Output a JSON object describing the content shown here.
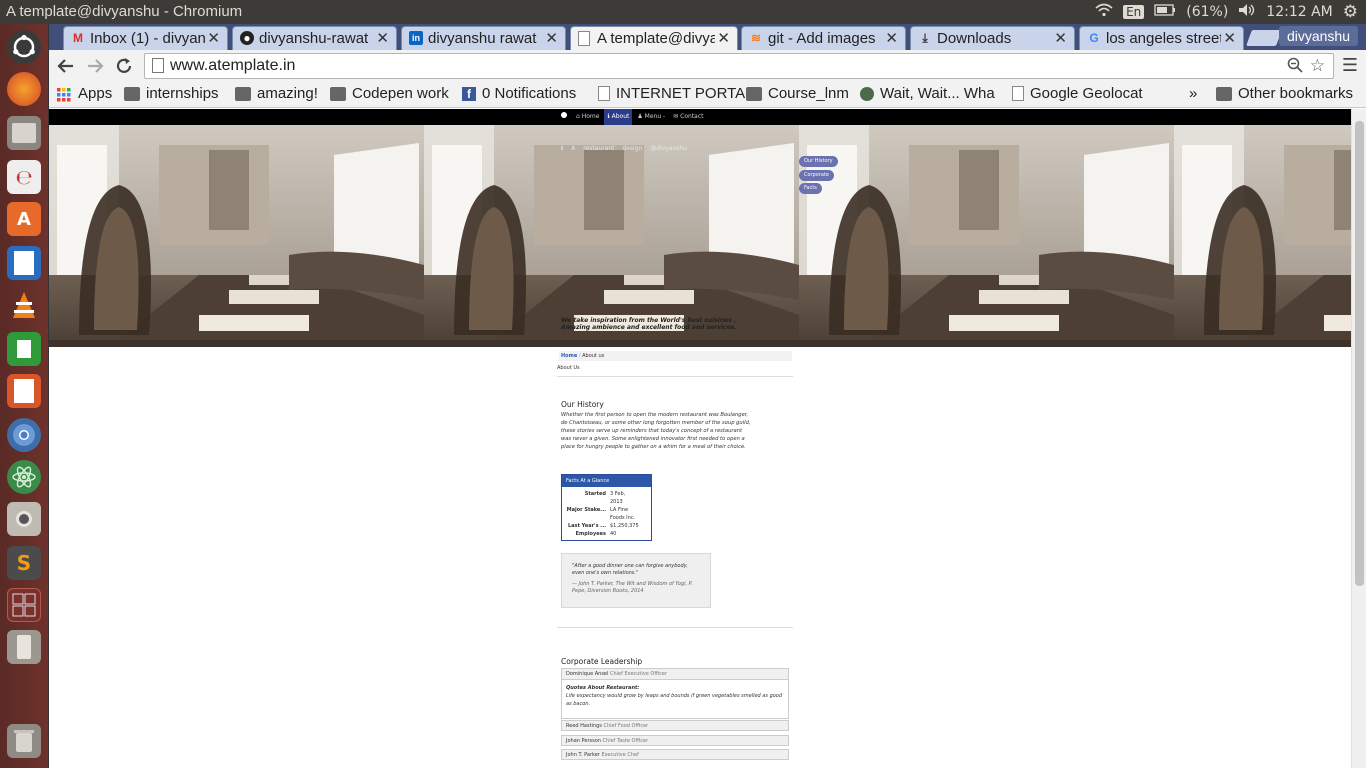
{
  "os": {
    "window_title": "A template@divyanshu - Chromium",
    "keyboard": "En",
    "battery": "(61%)",
    "clock": "12:12 AM"
  },
  "browser": {
    "tabs": [
      {
        "label": "Inbox (1) - divyanshu",
        "icon": "gmail-icon"
      },
      {
        "label": "divyanshu-rawat",
        "icon": "github-icon"
      },
      {
        "label": "divyanshu rawat",
        "icon": "linkedin-icon"
      },
      {
        "label": "A template@divyanshu",
        "icon": "page-icon",
        "active": true
      },
      {
        "label": "git - Add images",
        "icon": "stackoverflow-icon"
      },
      {
        "label": "Downloads",
        "icon": "download-icon"
      },
      {
        "label": "los angeles street",
        "icon": "google-icon"
      }
    ],
    "profile": "divyanshu",
    "url": "www.atemplate.in",
    "bookmarks": [
      {
        "label": "Apps",
        "icon": "apps-icon"
      },
      {
        "label": "internships",
        "icon": "folder-icon"
      },
      {
        "label": "amazing!",
        "icon": "folder-icon"
      },
      {
        "label": "Codepen work",
        "icon": "folder-icon"
      },
      {
        "label": "0 Notifications",
        "icon": "facebook-icon"
      },
      {
        "label": "INTERNET PORTA",
        "icon": "page-icon"
      },
      {
        "label": "Course_lnm",
        "icon": "folder-icon"
      },
      {
        "label": "Wait, Wait... Wha",
        "icon": "globe-icon"
      },
      {
        "label": "Google Geolocat",
        "icon": "page-icon"
      }
    ],
    "overflow": "»",
    "other_bookmarks": "Other bookmarks"
  },
  "page": {
    "nav": {
      "home": "Home",
      "about": "About",
      "menu": "Menu -",
      "contact": "Contact"
    },
    "hero": {
      "subtitle": "A restaurant design @divyanshu",
      "quote": "We take inspiration from the World's best cuisines , Amazing ambience and excellent food and services.",
      "side_links": [
        "Our History",
        "Corporate",
        "Facts"
      ]
    },
    "breadcrumb": {
      "home": "Home",
      "current": "About us"
    },
    "about_heading": "About Us",
    "history": {
      "title": "Our History",
      "text": "Whether the first person to open the modern restaurant was Boulanger, de Chantoiseau, or some other long forgotten member of the soup guild, these stories serve up reminders that today's concept of a restaurant was never a given. Some enlightened innovator first needed to open a place for hungry people to gather on a whim for a meal of their choice."
    },
    "facts": {
      "title": "Facts At a Glance",
      "rows": [
        {
          "key": "Started",
          "value": "3 Feb, 2013"
        },
        {
          "key": "Major Stake...",
          "value": "LA Fine Foods Inc."
        },
        {
          "key": "Last Year's ...",
          "value": "$1,250,375"
        },
        {
          "key": "Employees",
          "value": "40"
        }
      ]
    },
    "quote": {
      "text": "\"After a good dinner one can forgive anybody, even one's own relations.\"",
      "cite": "— John T. Parker, The Wit and Wisdom of Yogi, P. Pepe, Diversion Books, 2014"
    },
    "leadership": {
      "title": "Corporate Leadership",
      "people": [
        {
          "name": "Dominique Ansel",
          "role": "Chief Executive Officer"
        },
        {
          "name": "Reed Hastings",
          "role": "Chief Food Officer"
        },
        {
          "name": "Johan Persson",
          "role": "Chief Taste Officer"
        },
        {
          "name": "John T. Parker",
          "role": "Executive Chef"
        }
      ],
      "expanded": {
        "title": "Quotes About Restaurant:",
        "text": "Life expectancy would grow by leaps and bounds if green vegetables smelled as good as bacon."
      }
    }
  }
}
